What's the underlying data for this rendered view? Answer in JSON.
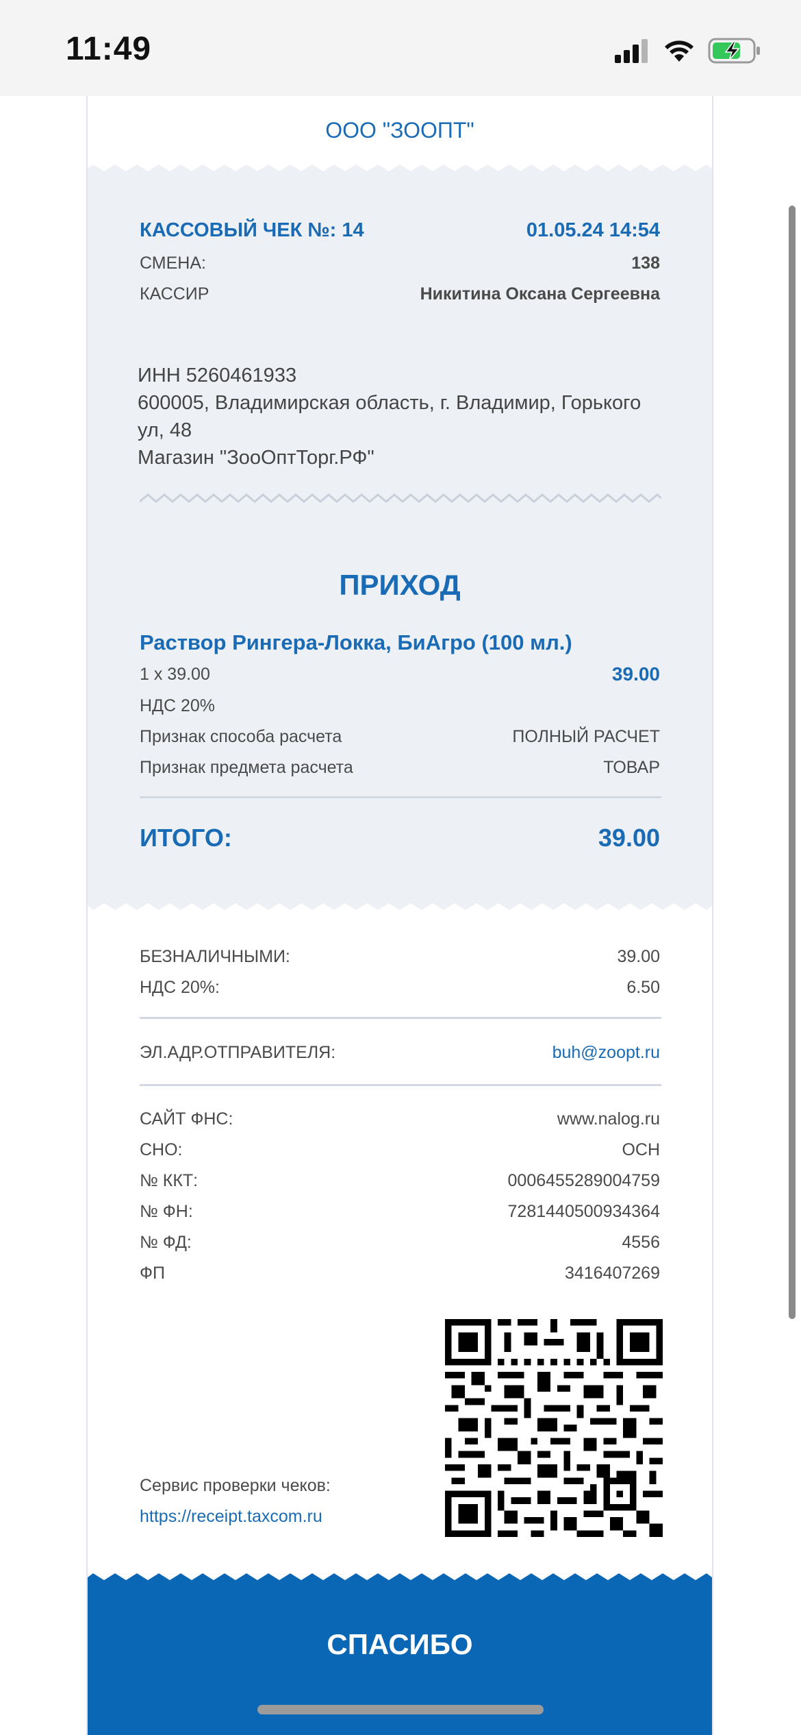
{
  "status_bar": {
    "time": "11:49"
  },
  "receipt": {
    "org_name": "ООО \"ЗООПТ\"",
    "check_title": "КАССОВЫЙ ЧЕК №: 14",
    "datetime": "01.05.24 14:54",
    "shift_label": "СМЕНА:",
    "shift_value": "138",
    "cashier_label": "КАССИР",
    "cashier_value": "Никитина Оксана Сергеевна",
    "inn": "ИНН 5260461933",
    "address_line1": "600005, Владимирская область, г. Владимир, Горького",
    "address_line2": "ул, 48",
    "shop": "Магазин \"ЗооОптТорг.РФ\"",
    "operation": "ПРИХОД",
    "item": {
      "name": "Раствор Рингера-Локка, БиАгро (100 мл.)",
      "qty_price": "1 х 39.00",
      "sum": "39.00",
      "vat": "НДС 20%",
      "payment_method_label": "Признак способа расчета",
      "payment_method_value": "ПОЛНЫЙ РАСЧЕТ",
      "subject_label": "Признак предмета расчета",
      "subject_value": "ТОВАР"
    },
    "total_label": "ИТОГО:",
    "total_value": "39.00",
    "cashless_label": "БЕЗНАЛИЧНЫМИ:",
    "cashless_value": "39.00",
    "vat_total_label": "НДС 20%:",
    "vat_total_value": "6.50",
    "sender_label": "ЭЛ.АДР.ОТПРАВИТЕЛЯ:",
    "sender_value": "buh@zoopt.ru",
    "fns_site_label": "САЙТ ФНС:",
    "fns_site_value": "www.nalog.ru",
    "sno_label": "СНО:",
    "sno_value": "ОСН",
    "kkt_label": "№ ККТ:",
    "kkt_value": "0006455289004759",
    "fn_label": "№ ФН:",
    "fn_value": "7281440500934364",
    "fd_label": "№ ФД:",
    "fd_value": "4556",
    "fp_label": "ФП",
    "fp_value": "3416407269",
    "check_service_label": "Сервис проверки чеков:",
    "check_service_link": "https://receipt.taxcom.ru",
    "thanks": "СПАСИБО"
  },
  "icons": [
    "cellular-signal-icon",
    "wifi-icon",
    "battery-charging-icon",
    "qr-code-icon"
  ],
  "colors": {
    "accent": "#1a6bb5",
    "band": "#0a67b6",
    "paper_gray": "#edf0f4"
  }
}
